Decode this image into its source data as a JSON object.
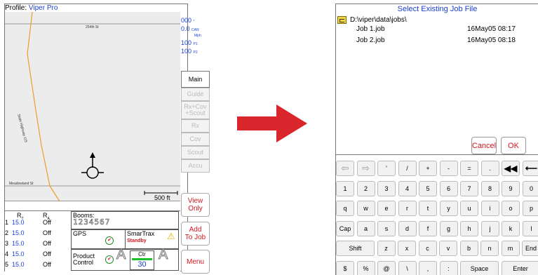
{
  "left_screen": {
    "profile_label": "Profile:",
    "profile_name": "Viper Pro",
    "map": {
      "street_top": "254th St",
      "street_diag": "State Highway 115",
      "street_bottom": "Meadowland St",
      "scale": "500 ft"
    },
    "readouts": {
      "speed_degrees": "000",
      "deg_unit": "°",
      "can_value": "0.0",
      "can_label": "CAN",
      "mph_label": "Mph",
      "p1_value": "100",
      "p1_label": "P1",
      "p2_value": "100",
      "p2_label": "P2"
    },
    "tabs": [
      "Main",
      "Guide",
      "Rx+Cov\n+Scout",
      "Rx",
      "Cov",
      "Scout",
      "Accu"
    ],
    "view_only": "View\nOnly",
    "add_to_job": "Add\nTo Job",
    "menu": "Menu",
    "rates": {
      "rt_header": "R",
      "rt_sub": "T",
      "ra_header": "R",
      "ra_sub": "A",
      "rows": [
        {
          "num": "1",
          "rt": "15.0",
          "ra": "Off"
        },
        {
          "num": "2",
          "rt": "15.0",
          "ra": "Off"
        },
        {
          "num": "3",
          "rt": "15.0",
          "ra": "Off"
        },
        {
          "num": "4",
          "rt": "15.0",
          "ra": "Off"
        },
        {
          "num": "5",
          "rt": "15.0",
          "ra": "Off"
        }
      ]
    },
    "booms_label": "Booms:",
    "booms_digits": "1234567",
    "gps_label": "GPS",
    "smartrax_label": "SmarTrax",
    "smartrax_status": "Standby",
    "product_control": "Product\nControl",
    "ctr_label": "Ctr",
    "ctr_value": "30",
    "accent_blue": "#1a3fd6",
    "accent_red": "#d4161d"
  },
  "right_screen": {
    "title": "Select Existing Job File",
    "path": "D:\\viper\\data\\jobs\\",
    "jobs": [
      {
        "name": "Job 1.job",
        "date": "16May05 08:17"
      },
      {
        "name": "Job 2.job",
        "date": "16May05 08:18"
      }
    ],
    "cancel": "Cancel",
    "ok": "OK",
    "keyboard": {
      "row1": [
        "⇦",
        "⇨",
        "'",
        "/",
        "+",
        "-",
        "=",
        ".",
        "◀◀",
        "⟵"
      ],
      "row2": [
        "1",
        "2",
        "3",
        "4",
        "5",
        "6",
        "7",
        "8",
        "9",
        "0"
      ],
      "row3": [
        "q",
        "w",
        "e",
        "r",
        "t",
        "y",
        "u",
        "i",
        "o",
        "p"
      ],
      "row4": [
        "Cap",
        "a",
        "s",
        "d",
        "f",
        "g",
        "h",
        "j",
        "k",
        "l"
      ],
      "row5": [
        "Shift",
        "z",
        "x",
        "c",
        "v",
        "b",
        "n",
        "m",
        "End"
      ],
      "row6": [
        "$",
        "%",
        "@",
        "\\",
        ",",
        ":",
        "Space",
        "Enter"
      ]
    }
  }
}
